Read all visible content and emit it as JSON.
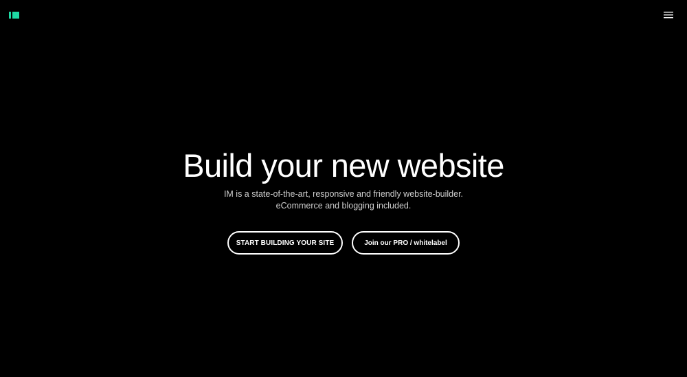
{
  "brand": {
    "logo_icon": "im-logo-icon",
    "accent_color": "#1ed9a4"
  },
  "header": {
    "menu_icon": "hamburger-menu-icon"
  },
  "hero": {
    "title": "Build your new website",
    "subtitle_line1": "IM is a state-of-the-art, responsive and friendly website-builder.",
    "subtitle_line2": "eCommerce and blogging included.",
    "primary_button": "START BUILDING YOUR SITE",
    "secondary_button": "Join our PRO / whitelabel"
  },
  "colors": {
    "background": "#000000",
    "text": "#ffffff",
    "subtext": "#cfcfcf"
  }
}
